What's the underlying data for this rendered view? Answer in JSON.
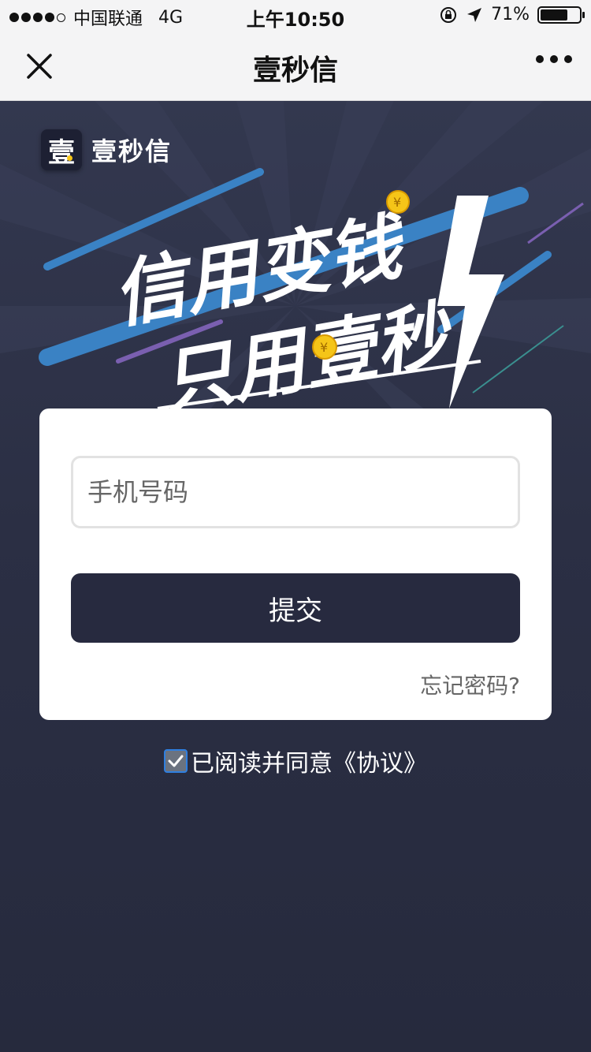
{
  "status_bar": {
    "carrier": "中国联通",
    "network": "4G",
    "time": "上午10:50",
    "battery": "71%",
    "battery_level": 0.71
  },
  "navbar": {
    "title": "壹秒信",
    "close_icon": "close-icon",
    "more_icon": "more-icon"
  },
  "banner": {
    "logo_char": "壹",
    "logo_text": "壹秒信",
    "slogan_line1": "信用变钱",
    "slogan_line2": "只用壹秒"
  },
  "form": {
    "phone_placeholder": "手机号码",
    "submit_label": "提交",
    "forgot_label": "忘记密码?"
  },
  "agreement": {
    "checked": true,
    "text": "已阅读并同意《协议》"
  },
  "colors": {
    "background": "#2a2e42",
    "button": "#272a3f",
    "card": "#ffffff",
    "accent_blue": "#3a82c4",
    "coin": "#f5c518"
  }
}
